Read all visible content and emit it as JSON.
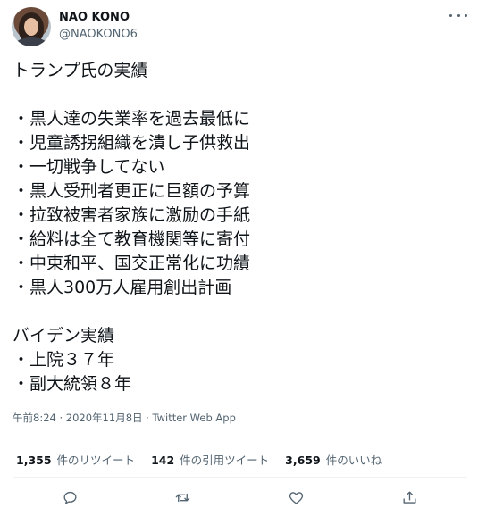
{
  "author": {
    "display_name": "NAO KONO",
    "handle": "@NAOKONO6"
  },
  "more_menu": {
    "icon": "more-horizontal-icon"
  },
  "tweet": {
    "lines": [
      "トランプ氏の実績",
      "",
      "・黒人達の失業率を過去最低に",
      "・児童誘拐組織を潰し子供救出",
      "・一切戦争してない",
      "・黒人受刑者更正に巨額の予算",
      "・拉致被害者家族に激励の手紙",
      "・給料は全て教育機関等に寄付",
      "・中東和平、国交正常化に功績",
      "・黒人300万人雇用創出計画",
      "",
      "バイデン実績",
      "・上院３７年",
      "・副大統領８年"
    ],
    "timestamp": "午前8:24 · 2020年11月8日 · Twitter Web App"
  },
  "stats": [
    {
      "count": "1,355",
      "label": "件のリツイート"
    },
    {
      "count": "142",
      "label": "件の引用ツイート"
    },
    {
      "count": "3,659",
      "label": "件のいいね"
    }
  ],
  "actions": [
    {
      "name": "reply",
      "icon": "reply-icon"
    },
    {
      "name": "retweet",
      "icon": "retweet-icon"
    },
    {
      "name": "like",
      "icon": "heart-icon"
    },
    {
      "name": "share",
      "icon": "share-icon"
    }
  ],
  "colors": {
    "primary_text": "#0f1419",
    "secondary_text": "#536471",
    "divider": "#eff3f4"
  }
}
